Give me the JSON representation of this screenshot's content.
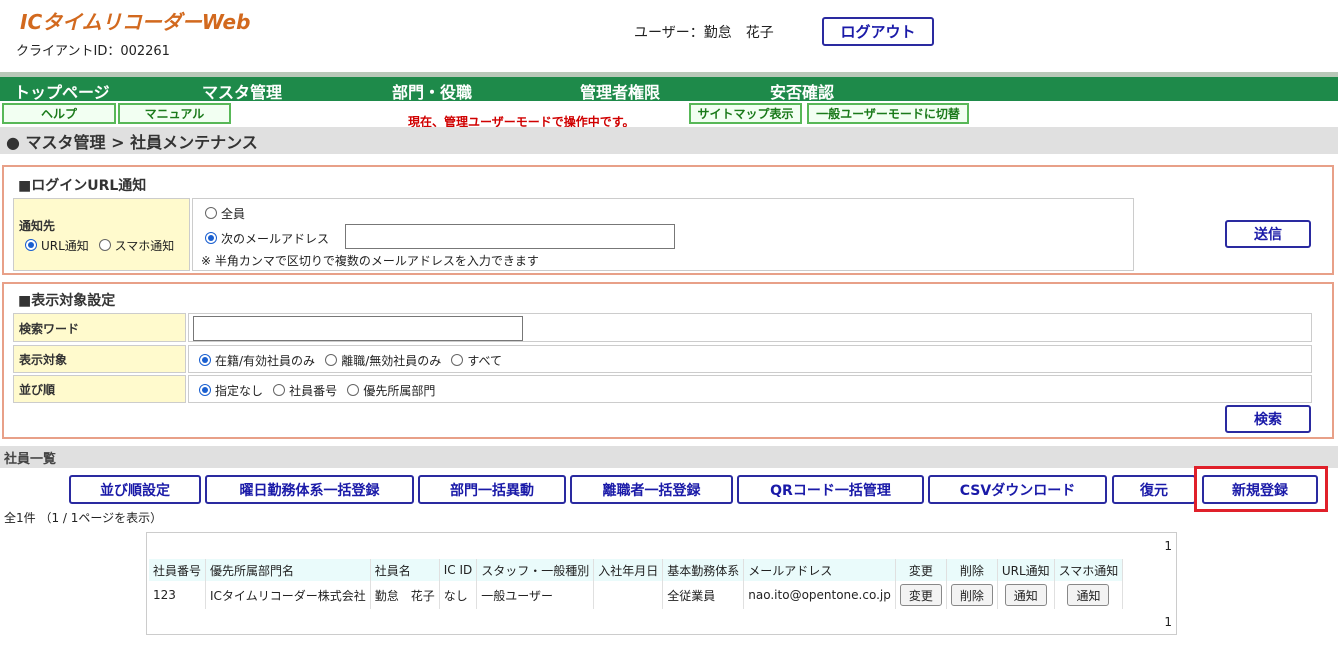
{
  "header": {
    "app_title": "ICタイムリコーダーWeb",
    "client_id": "クライアントID：002261",
    "user_label": "ユーザー：勤怠　花子",
    "logout_label": "ログアウト"
  },
  "nav": [
    "トップページ",
    "マスタ管理",
    "部門・役職",
    "管理者権限",
    "安否確認"
  ],
  "subnav": {
    "help": "ヘルプ",
    "manual": "マニュアル",
    "mode_message": "現在、管理ユーザーモードで操作中です。",
    "sitemap": "サイトマップ表示",
    "switch_mode": "一般ユーザーモードに切替"
  },
  "breadcrumb": "● マスタ管理 > 社員メンテナンス",
  "login_url": {
    "title": "■ログインURL通知",
    "dest_label": "通知先",
    "opt_url": "URL通知",
    "opt_smartphone": "スマホ通知",
    "opt_all": "全員",
    "opt_following": "次のメールアドレス",
    "email_value": "",
    "note": "※ 半角カンマで区切りで複数のメールアドレスを入力できます",
    "send_label": "送信"
  },
  "display_settings": {
    "title": "■表示対象設定",
    "search_word_label": "検索ワード",
    "search_word_value": "",
    "target_label": "表示対象",
    "target_opts": [
      "在籍/有効社員のみ",
      "離職/無効社員のみ",
      "すべて"
    ],
    "sort_label": "並び順",
    "sort_opts": [
      "指定なし",
      "社員番号",
      "優先所属部門"
    ],
    "search_label": "検索"
  },
  "employee_list": {
    "title": "社員一覧",
    "actions": [
      "並び順設定",
      "曜日勤務体系一括登録",
      "部門一括異動",
      "離職者一括登録",
      "QRコード一括管理",
      "CSVダウンロード",
      "復元"
    ],
    "new_label": "新規登録",
    "count": "全1件 （1 / 1ページを表示）",
    "page_top": "1",
    "page_bottom": "1",
    "columns": [
      "社員番号",
      "優先所属部門名",
      "社員名",
      "IC ID",
      "スタッフ・一般種別",
      "入社年月日",
      "基本勤務体系",
      "メールアドレス",
      "変更",
      "削除",
      "URL通知",
      "スマホ通知"
    ],
    "rows": [
      {
        "emp_no": "123",
        "dept": "ICタイムリコーダー株式会社",
        "name": "勤怠　花子",
        "ic_id": "なし",
        "type": "一般ユーザー",
        "join_date": "",
        "work_system": "全従業員",
        "email": "nao.ito@opentone.co.jp",
        "edit": "変更",
        "delete": "削除",
        "url_notify": "通知",
        "sp_notify": "通知"
      }
    ]
  }
}
